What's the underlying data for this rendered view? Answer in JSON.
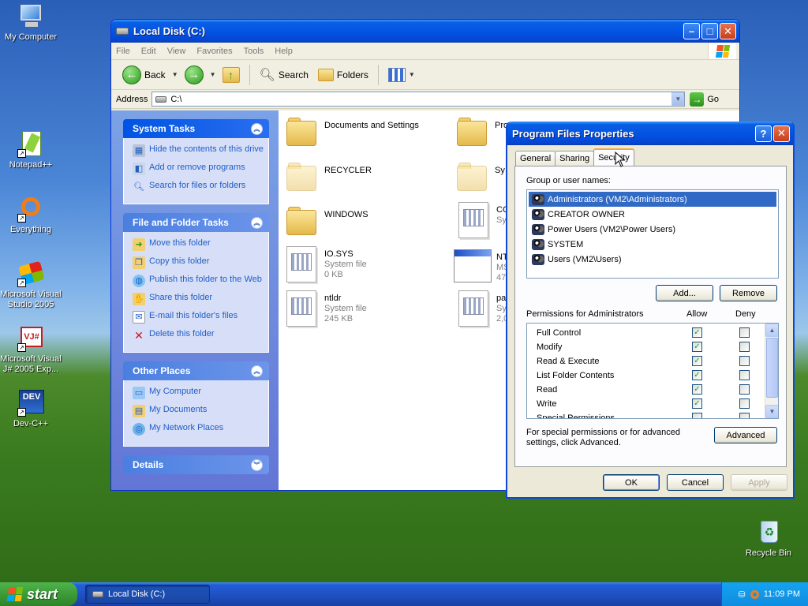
{
  "desktop": {
    "icons": [
      {
        "label": "My Computer",
        "icon": "my-computer-icon"
      },
      {
        "label": "Notepad++",
        "icon": "notepadpp-icon"
      },
      {
        "label": "Everything",
        "icon": "everything-search-icon"
      },
      {
        "label": "Microsoft Visual Studio 2005",
        "icon": "visual-studio-icon"
      },
      {
        "label": "Microsoft Visual J# 2005 Exp...",
        "icon": "visual-jsharp-icon",
        "badge": "VJ#"
      },
      {
        "label": "Dev-C++",
        "icon": "dev-cpp-icon",
        "badge": "DEV"
      },
      {
        "label": "Recycle Bin",
        "icon": "recycle-bin-icon"
      }
    ]
  },
  "explorer": {
    "title": "Local Disk (C:)",
    "menu": [
      "File",
      "Edit",
      "View",
      "Favorites",
      "Tools",
      "Help"
    ],
    "toolbar": {
      "back": "Back",
      "search": "Search",
      "folders": "Folders"
    },
    "address": {
      "label": "Address",
      "value": "C:\\",
      "go": "Go"
    },
    "tasks": {
      "system": {
        "title": "System Tasks",
        "items": [
          "Hide the contents of this drive",
          "Add or remove programs",
          "Search for files or folders"
        ]
      },
      "file_folder": {
        "title": "File and Folder Tasks",
        "items": [
          "Move this folder",
          "Copy this folder",
          "Publish this folder to the Web",
          "Share this folder",
          "E-mail this folder's files",
          "Delete this folder"
        ]
      },
      "other": {
        "title": "Other Places",
        "items": [
          "My Computer",
          "My Documents",
          "My Network Places"
        ]
      },
      "details": {
        "title": "Details"
      }
    },
    "files": [
      {
        "name": "Documents and Settings",
        "type": "folder"
      },
      {
        "name": "Pro",
        "type": "folder"
      },
      {
        "name": "RECYCLER",
        "type": "folder-hidden"
      },
      {
        "name": "Sy",
        "type": "folder-hidden"
      },
      {
        "name": "WINDOWS",
        "type": "folder"
      },
      {
        "name": "CO",
        "line2": "Sy",
        "type": "sysfile"
      },
      {
        "name": "IO.SYS",
        "line2": "System file",
        "line3": "0 KB",
        "type": "sysfile"
      },
      {
        "name": "NT",
        "line2": "MS",
        "line3": "47",
        "type": "winfile"
      },
      {
        "name": "ntldr",
        "line2": "System file",
        "line3": "245 KB",
        "type": "sysfile"
      },
      {
        "name": "pa",
        "line2": "Sy",
        "line3": "2,0",
        "type": "sysfile"
      }
    ]
  },
  "dialog": {
    "title": "Program Files Properties",
    "tabs": [
      "General",
      "Sharing",
      "Security"
    ],
    "active_tab": "Security",
    "group_label": "Group or user names:",
    "users": [
      "Administrators (VM2\\Administrators)",
      "CREATOR OWNER",
      "Power Users (VM2\\Power Users)",
      "SYSTEM",
      "Users (VM2\\Users)"
    ],
    "add_label": "Add...",
    "remove_label": "Remove",
    "permissions_label": "Permissions for Administrators",
    "allow_label": "Allow",
    "deny_label": "Deny",
    "permissions": [
      {
        "name": "Full Control",
        "allow": true,
        "deny": false
      },
      {
        "name": "Modify",
        "allow": true,
        "deny": false
      },
      {
        "name": "Read & Execute",
        "allow": true,
        "deny": false
      },
      {
        "name": "List Folder Contents",
        "allow": true,
        "deny": false
      },
      {
        "name": "Read",
        "allow": true,
        "deny": false
      },
      {
        "name": "Write",
        "allow": true,
        "deny": false
      },
      {
        "name": "Special Permissions",
        "allow": false,
        "deny": false
      }
    ],
    "advanced_text": "For special permissions or for advanced settings, click Advanced.",
    "advanced_label": "Advanced",
    "ok": "OK",
    "cancel": "Cancel",
    "apply": "Apply"
  },
  "taskbar": {
    "start": "start",
    "task": "Local Disk (C:)",
    "clock": "11:09 PM"
  }
}
